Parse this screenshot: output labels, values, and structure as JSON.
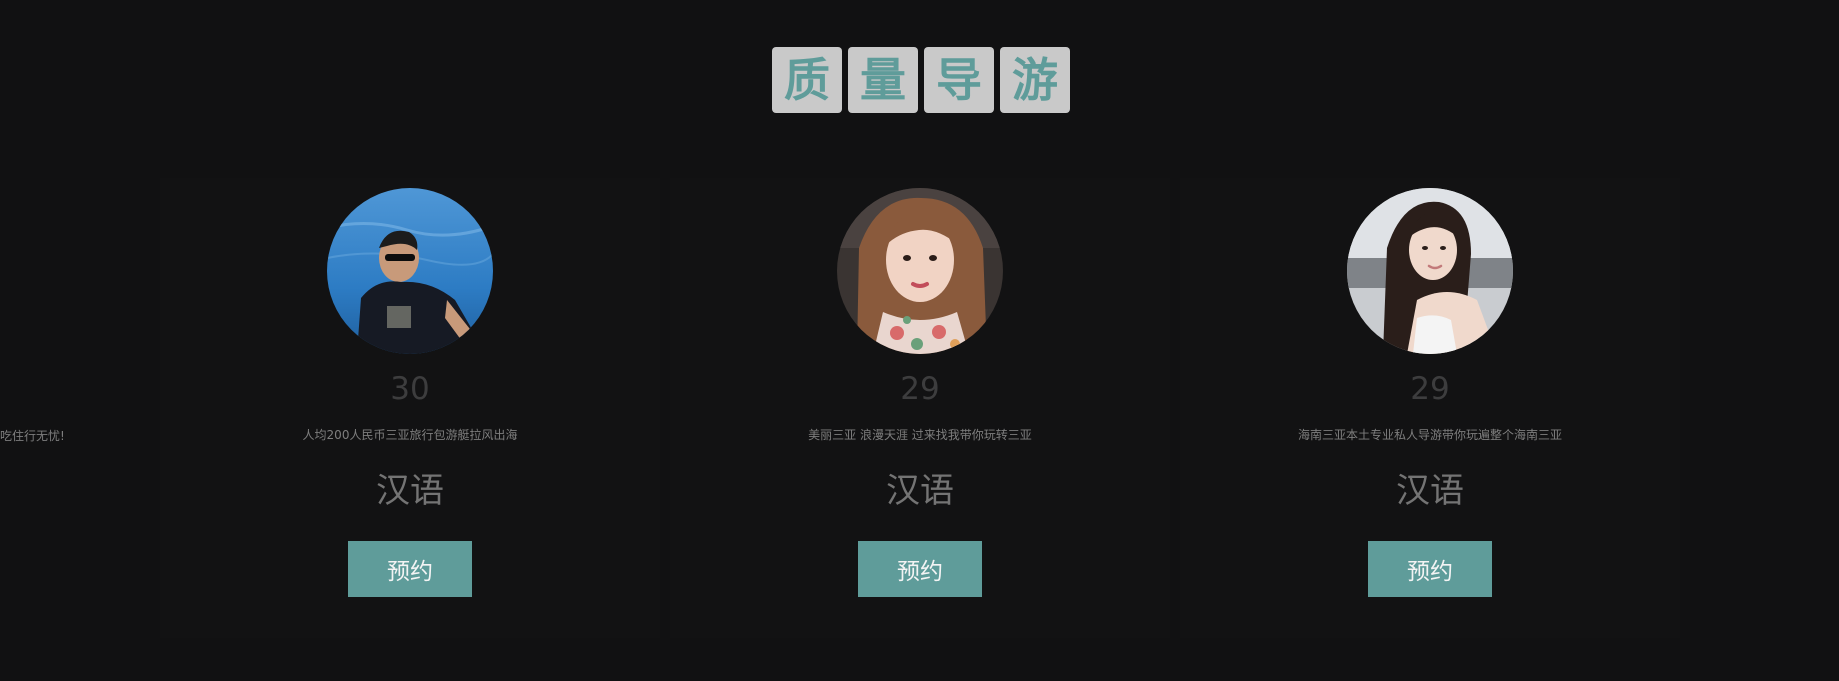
{
  "title": {
    "chars": [
      "质",
      "量",
      "导",
      "游"
    ]
  },
  "edge_text": "吃住行无忧!",
  "guides": [
    {
      "age": "30",
      "tagline": "人均200人民币三亚旅行包游艇拉风出海",
      "language": "汉语",
      "book_label": "预约"
    },
    {
      "age": "29",
      "tagline": "美丽三亚 浪漫天涯 过来找我带你玩转三亚",
      "language": "汉语",
      "book_label": "预约"
    },
    {
      "age": "29",
      "tagline": "海南三亚本土专业私人导游带你玩遍整个海南三亚",
      "language": "汉语",
      "book_label": "预约"
    }
  ],
  "colors": {
    "background": "#111112",
    "accent": "#5f9c9a",
    "title_tile": "#c9c9c9"
  }
}
